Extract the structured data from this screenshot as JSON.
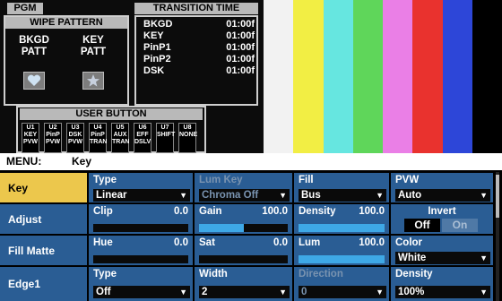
{
  "status": {
    "pgm": "PGM",
    "wipe_pattern": {
      "title": "WIPE PATTERN",
      "bkgd_top": "BKGD",
      "bkgd_bottom": "PATT",
      "key_top": "KEY",
      "key_bottom": "PATT",
      "bkgd_icon": "heart-icon",
      "key_icon": "star-icon"
    },
    "transition_time": {
      "title": "TRANSITION TIME",
      "rows": [
        {
          "name": "BKGD",
          "value": "01:00f"
        },
        {
          "name": "KEY",
          "value": "01:00f"
        },
        {
          "name": "PinP1",
          "value": "01:00f"
        },
        {
          "name": "PinP2",
          "value": "01:00f"
        },
        {
          "name": "DSK",
          "value": "01:00f"
        }
      ]
    },
    "user_button": {
      "title": "USER BUTTON",
      "buttons": [
        {
          "id": "U1",
          "l1": "KEY",
          "l2": "PVW"
        },
        {
          "id": "U2",
          "l1": "PinP",
          "l2": "PVW"
        },
        {
          "id": "U3",
          "l1": "DSK",
          "l2": "PVW"
        },
        {
          "id": "U4",
          "l1": "PinP",
          "l2": "TRAN"
        },
        {
          "id": "U5",
          "l1": "AUX",
          "l2": "TRAN"
        },
        {
          "id": "U6",
          "l1": "EFF",
          "l2": "DSLV"
        },
        {
          "id": "U7",
          "l1": "SHIFT",
          "l2": ""
        },
        {
          "id": "U8",
          "l1": "NONE",
          "l2": ""
        }
      ]
    }
  },
  "color_bars": [
    "#f2f2f2",
    "#f2ee44",
    "#66e6e0",
    "#5fd65a",
    "#ea7fe6",
    "#e9322e",
    "#2d46d8",
    "#000000"
  ],
  "menu": {
    "label": "MENU:",
    "current": "Key",
    "rows": {
      "key": {
        "name": "Key",
        "type": {
          "label": "Type",
          "value": "Linear"
        },
        "lum_key": {
          "label": "Lum Key",
          "value": "Chroma Off"
        },
        "fill": {
          "label": "Fill",
          "value": "Bus"
        },
        "pvw": {
          "label": "PVW",
          "value": "Auto"
        }
      },
      "adjust": {
        "name": "Adjust",
        "clip": {
          "label": "Clip",
          "value": "0.0",
          "level": 0
        },
        "gain": {
          "label": "Gain",
          "value": "100.0",
          "level": 0.5
        },
        "density": {
          "label": "Density",
          "value": "100.0",
          "level": 1.0
        },
        "invert": {
          "label": "Invert",
          "off": "Off",
          "on": "On",
          "state": "Off"
        }
      },
      "fill_matte": {
        "name": "Fill Matte",
        "hue": {
          "label": "Hue",
          "value": "0.0",
          "level": 0
        },
        "sat": {
          "label": "Sat",
          "value": "0.0",
          "level": 0
        },
        "lum": {
          "label": "Lum",
          "value": "100.0",
          "level": 1.0
        },
        "color": {
          "label": "Color",
          "value": "White"
        }
      },
      "edge1": {
        "name": "Edge1",
        "type": {
          "label": "Type",
          "value": "Off"
        },
        "width": {
          "label": "Width",
          "value": "2"
        },
        "direction": {
          "label": "Direction",
          "value": "0"
        },
        "density": {
          "label": "Density",
          "value": "100%"
        }
      }
    }
  },
  "colors": {
    "panel_blue": "#2a5d94",
    "selected": "#ecc74c",
    "bar_fill": "#3ea8e6"
  }
}
